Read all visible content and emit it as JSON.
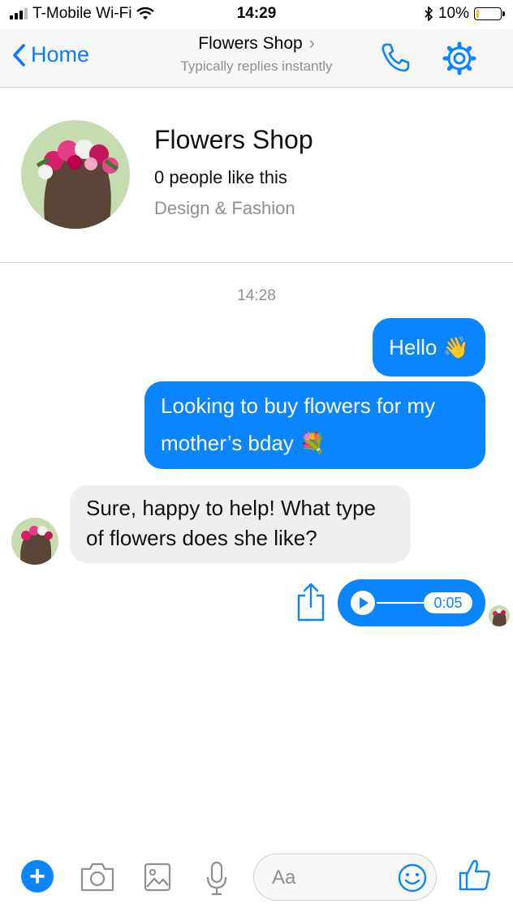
{
  "status_bar": {
    "carrier": "T-Mobile Wi-Fi",
    "time": "14:29",
    "battery": "10%",
    "battery_level": 0.1
  },
  "nav": {
    "back_label": "Home",
    "title": "Flowers Shop",
    "subtitle": "Typically replies instantly"
  },
  "profile": {
    "name": "Flowers Shop",
    "likes": "0 people like this",
    "category": "Design & Fashion"
  },
  "conversation": {
    "timestamp": "14:28",
    "messages": [
      {
        "from": "me",
        "text": "Hello 👋"
      },
      {
        "from": "me",
        "text": "Looking to buy flowers for my mother’s bday 💐"
      },
      {
        "from": "page",
        "text": "Sure, happy to help! What type of flowers does she like?"
      }
    ],
    "audio": {
      "duration": "0:05"
    }
  },
  "composer": {
    "placeholder": "Aa"
  },
  "colors": {
    "accent": "#0a84ff",
    "incoming_bubble": "#efeff0"
  }
}
